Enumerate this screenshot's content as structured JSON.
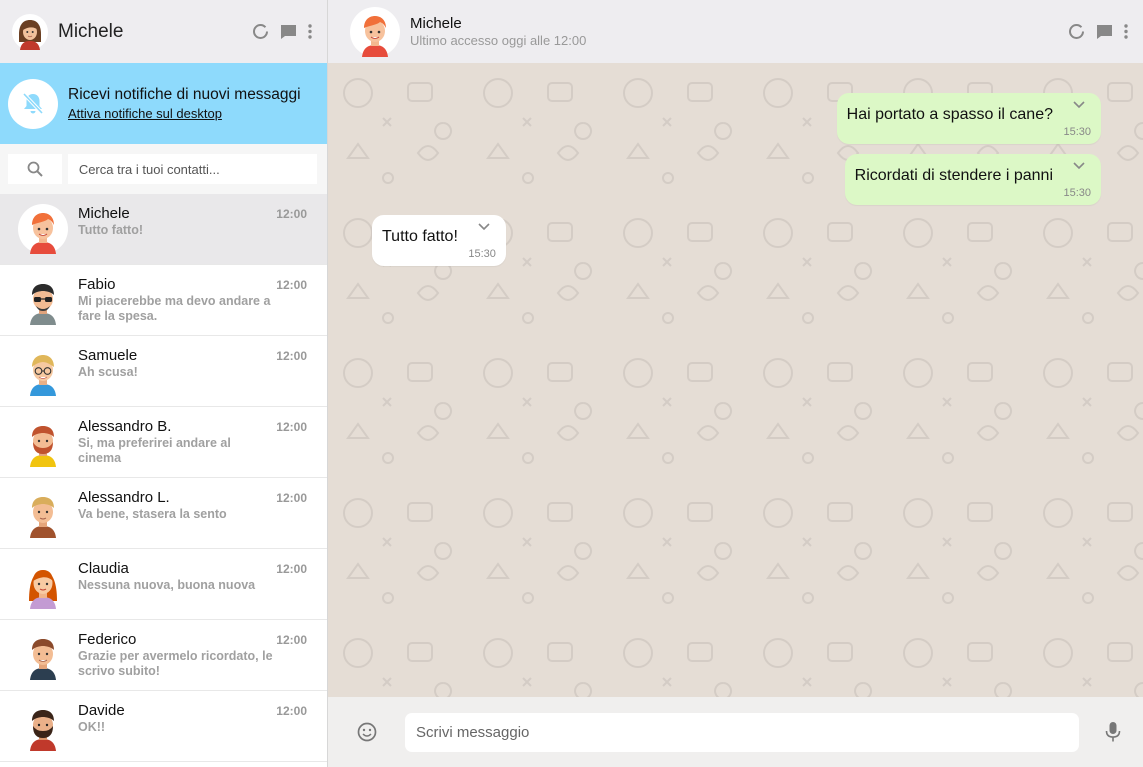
{
  "sidebar": {
    "user": {
      "name": "Michele",
      "avatar": "female-avatar"
    },
    "header_icons": [
      "status-icon",
      "chat-icon",
      "menu-icon"
    ],
    "notification": {
      "icon": "bell-off-icon",
      "title": "Ricevi notifiche di nuovi messaggi",
      "link": "Attiva notifiche sul desktop"
    },
    "search": {
      "placeholder": "Cerca tra i tuoi contatti...",
      "value": ""
    },
    "contacts": [
      {
        "name": "Michele",
        "time": "12:00",
        "message": "Tutto fatto!",
        "active": true,
        "avatar": "redhair"
      },
      {
        "name": "Fabio",
        "time": "12:00",
        "message": "Mi piacerebbe ma devo andare a fare la spesa.",
        "active": false,
        "avatar": "sunglasses"
      },
      {
        "name": "Samuele",
        "time": "12:00",
        "message": "Ah scusa!",
        "active": false,
        "avatar": "glasses"
      },
      {
        "name": "Alessandro B.",
        "time": "12:00",
        "message": "Si, ma preferirei andare al cinema",
        "active": false,
        "avatar": "beard-red"
      },
      {
        "name": "Alessandro L.",
        "time": "12:00",
        "message": "Va bene, stasera la sento",
        "active": false,
        "avatar": "blond"
      },
      {
        "name": "Claudia",
        "time": "12:00",
        "message": "Nessuna nuova, buona nuova",
        "active": false,
        "avatar": "woman-red"
      },
      {
        "name": "Federico",
        "time": "12:00",
        "message": "Grazie per avermelo ricordato, le scrivo subito!",
        "active": false,
        "avatar": "brown"
      },
      {
        "name": "Davide",
        "time": "12:00",
        "message": "OK!!",
        "active": false,
        "avatar": "beard-dark"
      }
    ]
  },
  "chat": {
    "header": {
      "name": "Michele",
      "status": "Ultimo accesso oggi alle 12:00"
    },
    "messages": [
      {
        "text": "Hai portato a spasso il cane?",
        "time": "15:30",
        "direction": "sent"
      },
      {
        "text": "Ricordati di stendere i panni",
        "time": "15:30",
        "direction": "sent"
      },
      {
        "text": "Tutto fatto!",
        "time": "15:30",
        "direction": "received"
      }
    ],
    "composer": {
      "placeholder": "Scrivi messaggio",
      "value": ""
    }
  },
  "colors": {
    "sent_bubble": "#dcf8c6",
    "received_bubble": "#ffffff",
    "notification_bg": "#8edafc",
    "chat_bg": "#e5ddd5",
    "header_bg": "#eeedf0"
  }
}
